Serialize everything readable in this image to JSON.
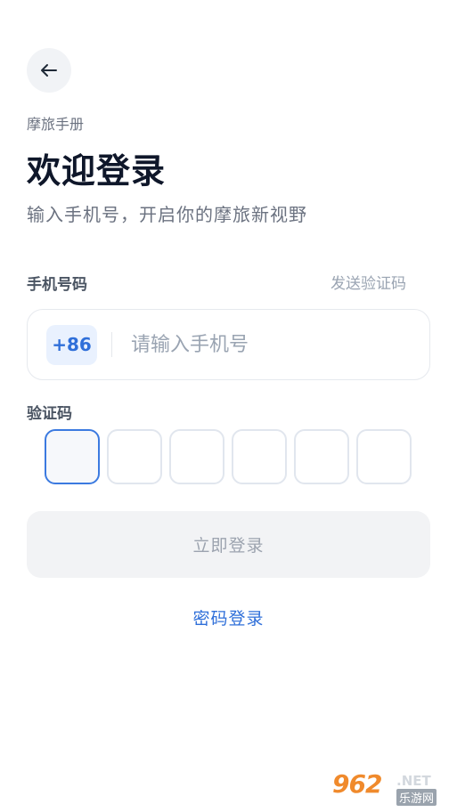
{
  "header": {
    "back_icon": "arrow-left-icon",
    "app_name": "摩旅手册",
    "title": "欢迎登录",
    "subtitle": "输入手机号，开启你的摩旅新视野"
  },
  "phone": {
    "label": "手机号码",
    "send_code": "发送验证码",
    "country_code": "+86",
    "placeholder": "请输入手机号",
    "value": ""
  },
  "verification": {
    "label": "验证码",
    "digits": [
      "",
      "",
      "",
      "",
      "",
      ""
    ],
    "active_index": 0
  },
  "actions": {
    "login_label": "立即登录",
    "password_login_label": "密码登录"
  },
  "watermark": {
    "number": "962",
    "suffix": ".NET",
    "site": "乐游网"
  },
  "colors": {
    "accent": "#2f6fd9",
    "active_border": "#3b7ae0",
    "muted": "#9aa4b2",
    "button_bg": "#f2f3f5"
  }
}
